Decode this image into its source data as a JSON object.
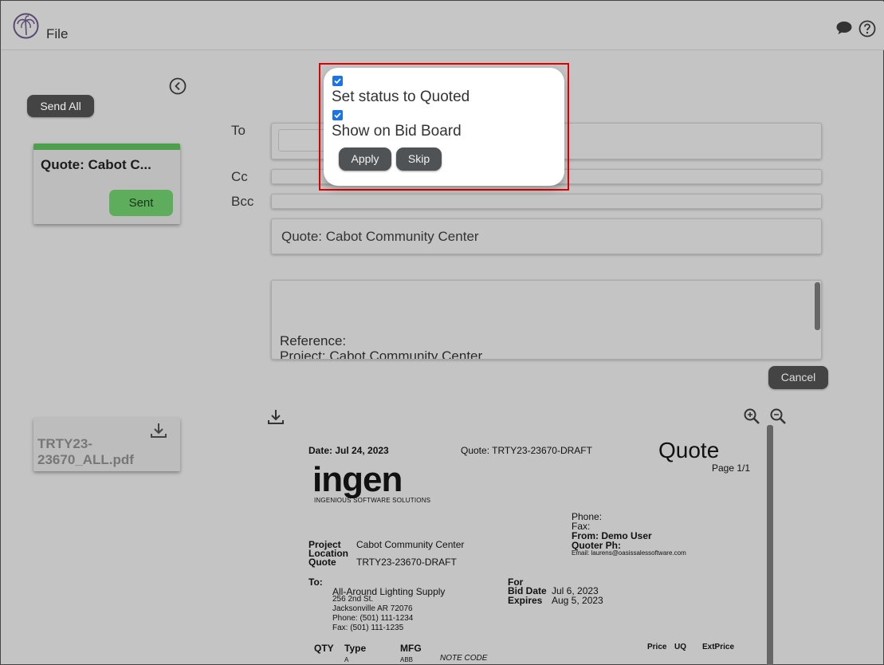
{
  "header": {
    "menu_file": "File"
  },
  "sidebar": {
    "send_all_label": "Send All",
    "email_card": {
      "title": "Quote: Cabot C...",
      "status_label": "Sent"
    },
    "attachment": {
      "file_name": "TRTY23-23670_ALL.pdf"
    }
  },
  "email": {
    "to_label": "To",
    "cc_label": "Cc",
    "bcc_label": "Bcc",
    "subject": "Quote: Cabot Community Center",
    "body_line1": "Reference:",
    "body_line2": "Project: Cabot Community Center",
    "cancel_label": "Cancel"
  },
  "pdf": {
    "date": "Date: Jul 24, 2023",
    "quote_no": "Quote: TRTY23-23670-DRAFT",
    "heading": "Quote",
    "page": "Page 1/1",
    "logo_text": "ingen",
    "logo_tagline": "INGENIOUS SOFTWARE SOLUTIONS",
    "phone": "Phone:",
    "fax": "Fax:",
    "from": "From: Demo User",
    "quoter_ph": "Quoter Ph:",
    "email": "Email: laurens@oasissalessoftware.com",
    "project_label": "Project",
    "location_label": "Location",
    "quote_label": "Quote",
    "project_value": "Cabot Community Center",
    "quote_value": "TRTY23-23670-DRAFT",
    "to_label": "To:",
    "to_name": "All-Around Lighting Supply",
    "to_address1": "256 2nd St.",
    "to_address2": "Jacksonville AR 72076",
    "to_phone": "Phone: (501) 111-1234",
    "to_fax": "Fax: (501) 111-1235",
    "for_label": "For",
    "bid_date_label": "Bid Date",
    "bid_date_value": "Jul 6, 2023",
    "expires_label": "Expires",
    "expires_value": "Aug 5, 2023",
    "col_qty": "QTY",
    "col_type": "Type",
    "col_mfg": "MFG",
    "col_price": "Price",
    "col_uq": "UQ",
    "col_extprice": "ExtPrice",
    "row1_type": "A",
    "row1_mfg": "ABB",
    "row1_note": "NOTE CODE"
  },
  "modal": {
    "option1_label": "Set status to Quoted",
    "option2_label": "Show on Bid Board",
    "apply_label": "Apply",
    "skip_label": "Skip"
  }
}
